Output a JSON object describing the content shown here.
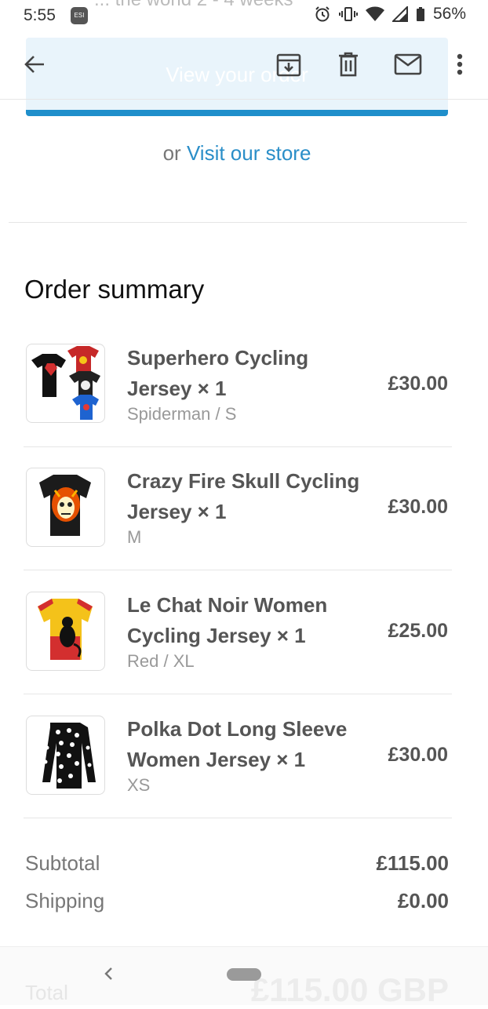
{
  "status_bar": {
    "time": "5:55",
    "app_icon_label": "ESI",
    "background_text": "... the world 2 - 4 weeks",
    "battery": "56%"
  },
  "email": {
    "view_order_button": "View your order",
    "store_prefix": "or",
    "store_link": "Visit our store"
  },
  "order_summary": {
    "title": "Order summary",
    "items": [
      {
        "name": "Superhero Cycling Jersey × 1",
        "variant": "Spiderman / S",
        "price": "£30.00"
      },
      {
        "name": "Crazy Fire Skull Cycling Jersey × 1",
        "variant": "M",
        "price": "£30.00"
      },
      {
        "name": "Le Chat Noir Women Cycling Jersey × 1",
        "variant": "Red / XL",
        "price": "£25.00"
      },
      {
        "name": "Polka Dot Long Sleeve Women Jersey × 1",
        "variant": "XS",
        "price": "£30.00"
      }
    ],
    "subtotal_label": "Subtotal",
    "subtotal_value": "£115.00",
    "shipping_label": "Shipping",
    "shipping_value": "£0.00",
    "total_label": "Total",
    "total_value": "£115.00 GBP"
  },
  "colors": {
    "accent": "#1f8fcb",
    "link": "#2a8ec8"
  }
}
